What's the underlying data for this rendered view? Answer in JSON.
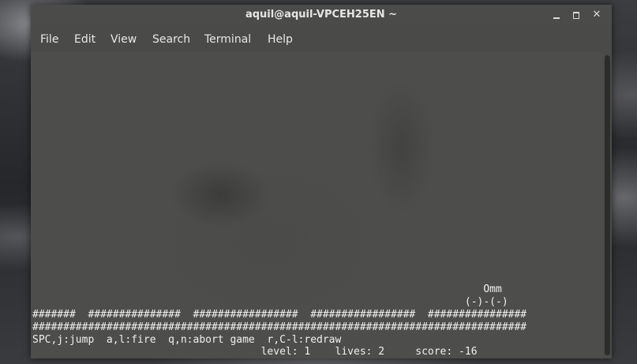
{
  "window": {
    "title": "aquil@aquil-VPCEH25EN ~"
  },
  "window_controls": {
    "minimize_icon": "minimize-icon",
    "maximize_icon": "maximize-icon",
    "close_icon": "close-icon",
    "close_glyph": "✕"
  },
  "menu": {
    "items": [
      {
        "label": "File"
      },
      {
        "label": "Edit"
      },
      {
        "label": "View"
      },
      {
        "label": "Search"
      },
      {
        "label": "Terminal"
      },
      {
        "label": "Help"
      }
    ]
  },
  "terminal": {
    "lines": [
      "                                                                         Omm",
      "                                                                      (-)-(-)",
      "#######  ###############  #################  #################  ################",
      "################################################################################",
      "SPC,j:jump  a,l:fire  q,n:abort game  r,C-l:redraw",
      "                                     level: 1    lives: 2     score: -16"
    ],
    "status": {
      "level": 1,
      "lives": 2,
      "score": -16
    }
  },
  "colors": {
    "terminal_background": "#4d4d4b",
    "terminal_text": "#f0f0f0",
    "titlebar": "#4b4b4a"
  }
}
